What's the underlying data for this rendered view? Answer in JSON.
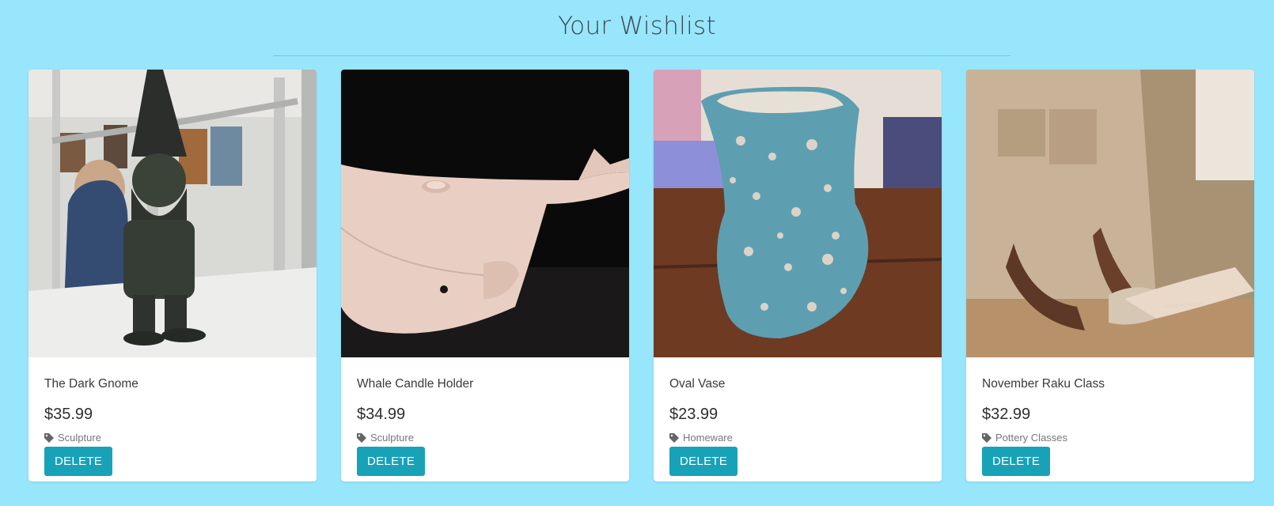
{
  "header": {
    "title": "Your Wishlist"
  },
  "items": [
    {
      "name": "The Dark Gnome",
      "price": "$35.99",
      "category": "Sculpture",
      "action": "DELETE"
    },
    {
      "name": "Whale Candle Holder",
      "price": "$34.99",
      "category": "Sculpture",
      "action": "DELETE"
    },
    {
      "name": "Oval Vase",
      "price": "$23.99",
      "category": "Homeware",
      "action": "DELETE"
    },
    {
      "name": "November Raku Class",
      "price": "$32.99",
      "category": "Pottery Classes",
      "action": "DELETE"
    }
  ],
  "colors": {
    "background": "#98e6fc",
    "button": "#17a2b8",
    "card": "#ffffff"
  },
  "icons": {
    "category": "tag-icon"
  }
}
